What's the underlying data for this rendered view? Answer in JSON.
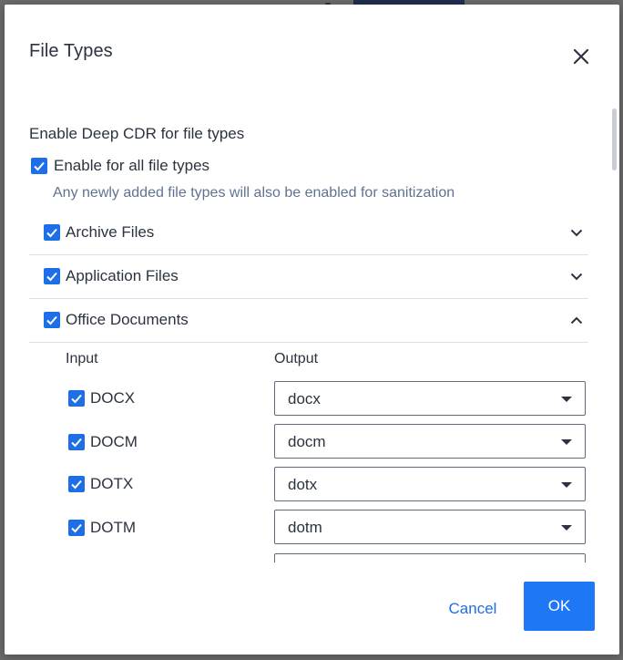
{
  "dialog": {
    "title": "File Types",
    "close_icon": "close-icon",
    "section_title": "Enable Deep CDR for file types",
    "enable_all": {
      "label": "Enable for all file types",
      "checked": true
    },
    "hint": "Any newly added file types will also be enabled for sanitization",
    "groups": [
      {
        "label": "Archive Files",
        "checked": true,
        "expanded": false,
        "icon": "chevron-down-icon"
      },
      {
        "label": "Application Files",
        "checked": true,
        "expanded": false,
        "icon": "chevron-down-icon"
      },
      {
        "label": "Office Documents",
        "checked": true,
        "expanded": true,
        "icon": "chevron-up-icon"
      }
    ],
    "columns": {
      "input": "Input",
      "output": "Output"
    },
    "file_types": [
      {
        "input": "DOCX",
        "output": "docx",
        "checked": true
      },
      {
        "input": "DOCM",
        "output": "docm",
        "checked": true
      },
      {
        "input": "DOTX",
        "output": "dotx",
        "checked": true
      },
      {
        "input": "DOTM",
        "output": "dotm",
        "checked": true
      }
    ],
    "buttons": {
      "cancel": "Cancel",
      "ok": "OK"
    },
    "colors": {
      "accent": "#1e6ee8",
      "ok_button": "#1e78f5",
      "hint_text": "#5f7390"
    }
  }
}
